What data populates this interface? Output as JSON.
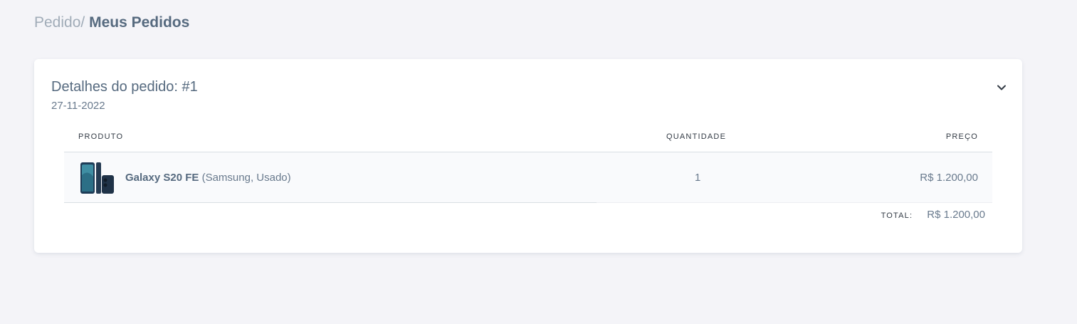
{
  "breadcrumb": {
    "parent": "Pedido/",
    "current": "Meus Pedidos"
  },
  "order": {
    "title": "Detalhes do pedido: #1",
    "date": "27-11-2022",
    "toggle_icon": "chevron-down-icon",
    "columns": {
      "product": "PRODUTO",
      "quantity": "QUANTIDADE",
      "price": "PREÇO"
    },
    "items": [
      {
        "name": "Galaxy S20 FE",
        "detail": "(Samsung, Usado)",
        "quantity": "1",
        "price": "R$ 1.200,00"
      }
    ],
    "total_label": "TOTAL:",
    "total_value": "R$ 1.200,00"
  },
  "colors": {
    "background": "#f4f4f8",
    "card": "#ffffff",
    "text": "#566a7f",
    "muted": "#a1acb8"
  }
}
